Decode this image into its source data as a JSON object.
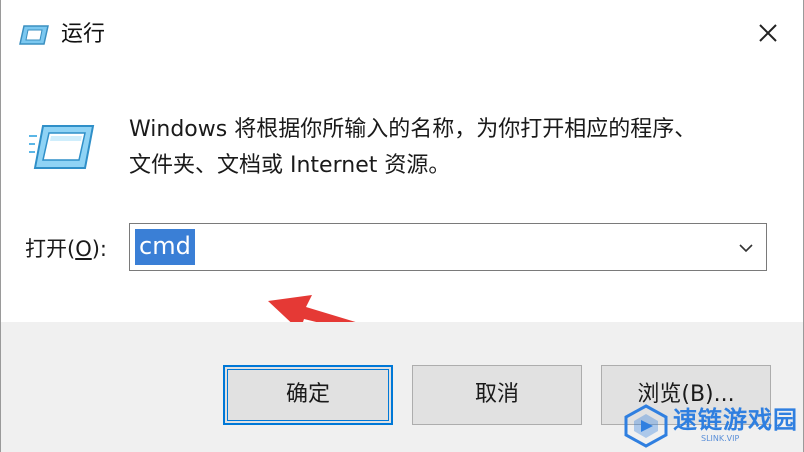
{
  "window": {
    "title": "运行"
  },
  "content": {
    "description_line1": "Windows 将根据你所输入的名称，为你打开相应的程序、",
    "description_line2": "文件夹、文档或 Internet 资源。",
    "open_label_prefix": "打开(",
    "open_label_accel": "O",
    "open_label_suffix": "):",
    "open_value": "cmd"
  },
  "buttons": {
    "ok": "确定",
    "cancel": "取消",
    "browse": "浏览(B)..."
  },
  "watermark": {
    "text": "速链游戏园",
    "sub": "SLINK.VIP"
  },
  "colors": {
    "selection": "#3a7fd6",
    "accent": "#0078d7",
    "arrow": "#e53935",
    "footer_bg": "#f0f0f0"
  },
  "icons": [
    "run-icon",
    "close-icon",
    "chevron-down-icon",
    "red-arrow",
    "watermark-logo"
  ]
}
